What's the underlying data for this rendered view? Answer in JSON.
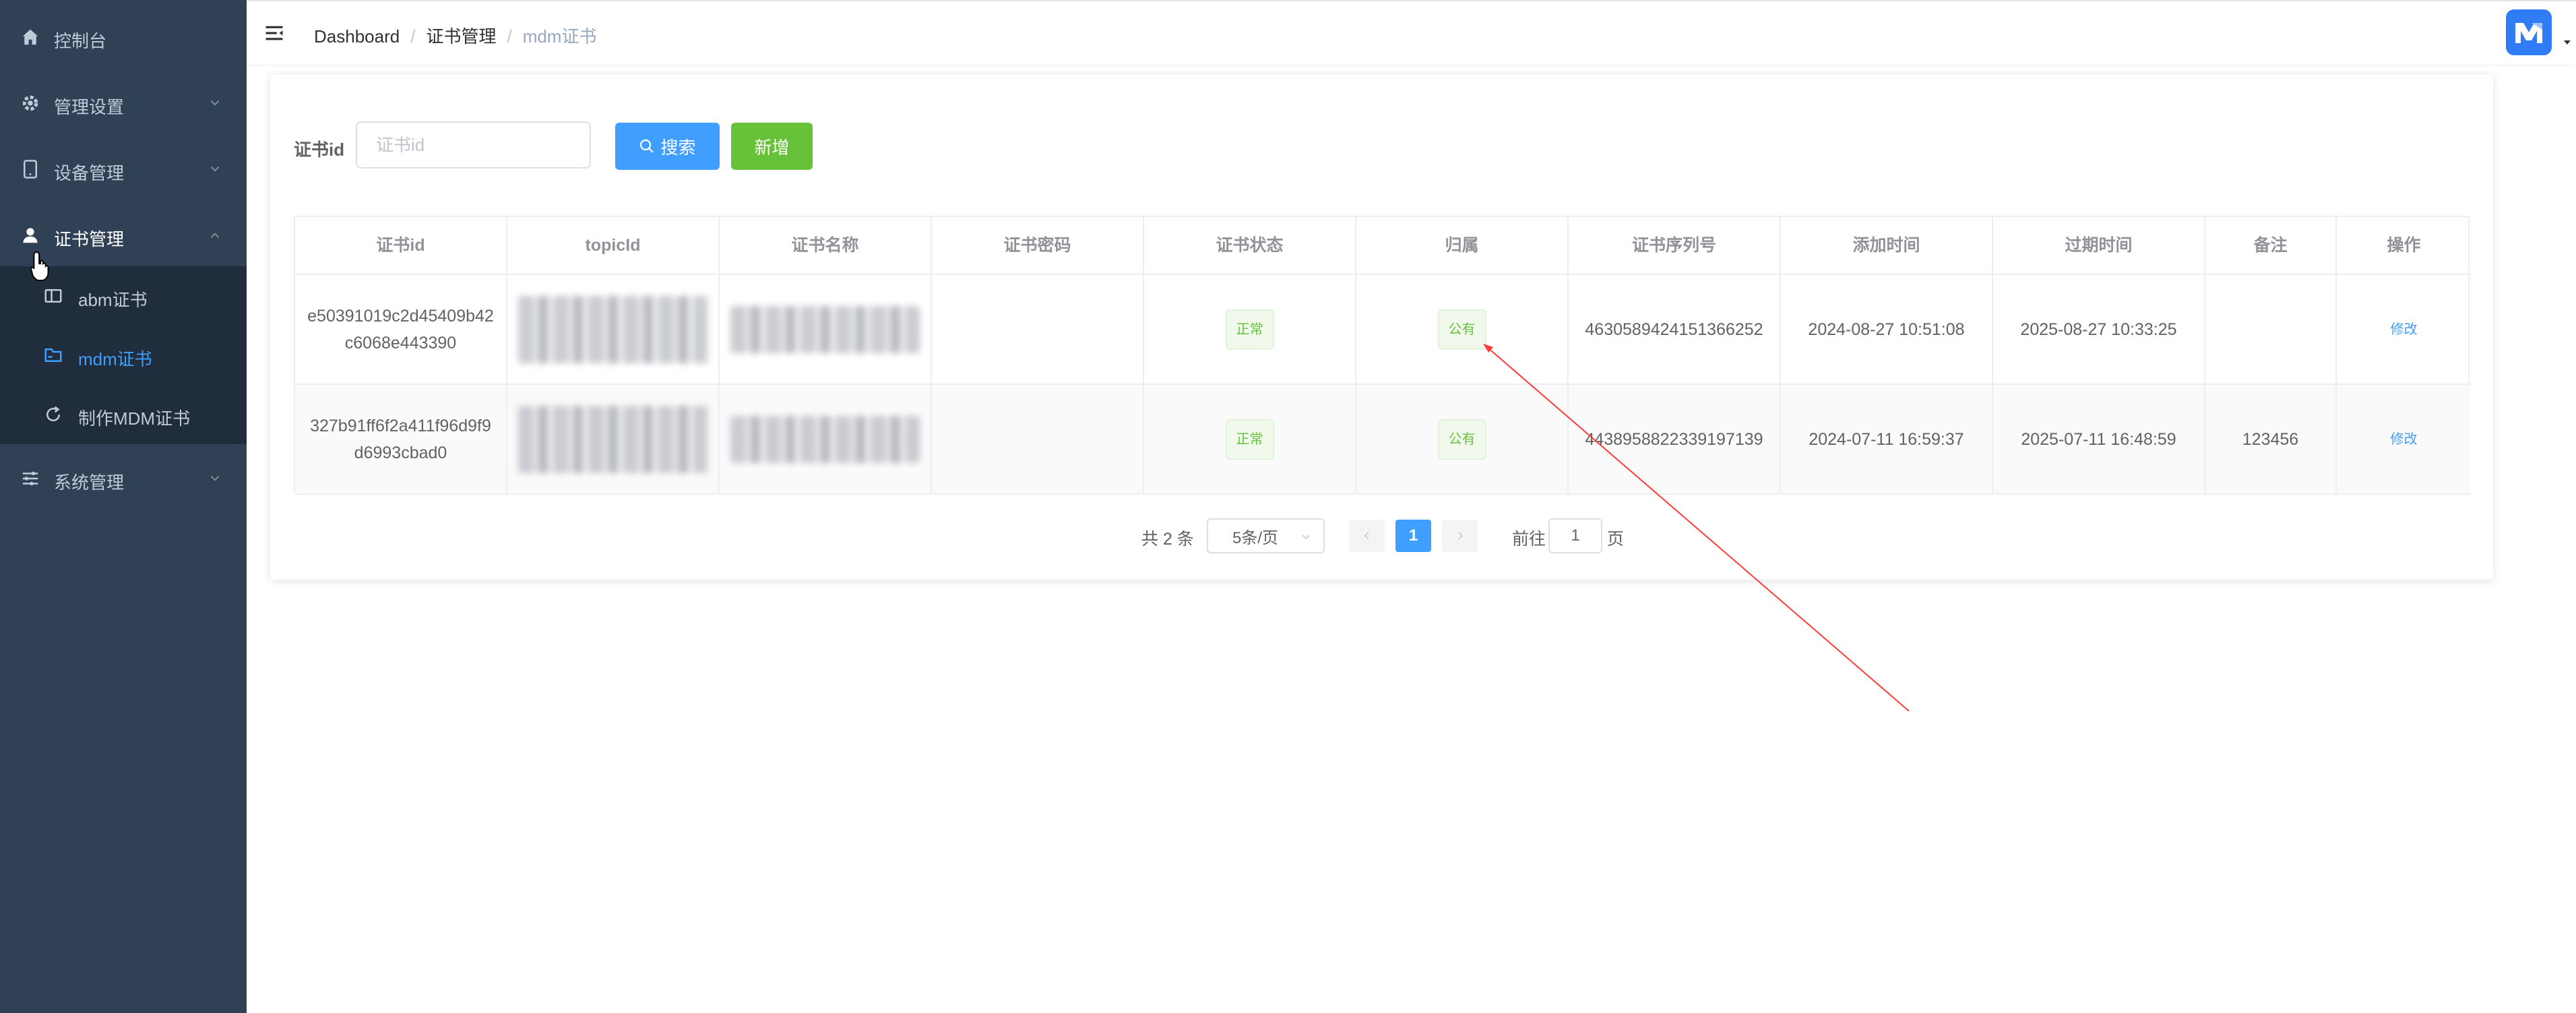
{
  "sidebar": {
    "items": [
      {
        "label": "控制台",
        "icon": "home-icon"
      },
      {
        "label": "管理设置",
        "icon": "gear-icon"
      },
      {
        "label": "设备管理",
        "icon": "tablet-icon"
      },
      {
        "label": "证书管理",
        "icon": "user-icon"
      },
      {
        "label": "系统管理",
        "icon": "sliders-icon"
      }
    ],
    "submenu": [
      {
        "label": "abm证书",
        "icon": "book-icon"
      },
      {
        "label": "mdm证书",
        "icon": "folder-icon",
        "active": true
      },
      {
        "label": "制作MDM证书",
        "icon": "refresh-icon"
      }
    ]
  },
  "header": {
    "breadcrumb": [
      "Dashboard",
      "证书管理",
      "mdm证书"
    ]
  },
  "search": {
    "label": "证书id",
    "placeholder": "证书id",
    "search_button": "搜索",
    "add_button": "新增"
  },
  "table": {
    "columns": [
      "证书id",
      "topicId",
      "证书名称",
      "证书密码",
      "证书状态",
      "归属",
      "证书序列号",
      "添加时间",
      "过期时间",
      "备注",
      "操作"
    ],
    "rows": [
      {
        "cert_id": "e50391019c2d45409b42c6068e443390",
        "topic_id": "",
        "cert_name": "",
        "cert_password": "",
        "status": "正常",
        "ownership": "公有",
        "serial": "4630589424151366252",
        "added": "2024-08-27 10:51:08",
        "expires": "2025-08-27 10:33:25",
        "remark": "",
        "action": "修改"
      },
      {
        "cert_id": "327b91ff6f2a411f96d9f9d6993cbad0",
        "topic_id": "",
        "cert_name": "",
        "cert_password": "",
        "status": "正常",
        "ownership": "公有",
        "serial": "4438958822339197139",
        "added": "2024-07-11 16:59:37",
        "expires": "2025-07-11 16:48:59",
        "remark": "123456",
        "action": "修改"
      }
    ]
  },
  "pagination": {
    "total": "共 2 条",
    "page_size": "5条/页",
    "current_page": "1",
    "goto_label": "前往",
    "goto_value": "1",
    "page_suffix": "页"
  },
  "colors": {
    "sidebar_bg": "#304156",
    "submenu_bg": "#1f2d3d",
    "primary": "#409eff",
    "success": "#67c23a",
    "annotation": "#ff3b3b"
  }
}
